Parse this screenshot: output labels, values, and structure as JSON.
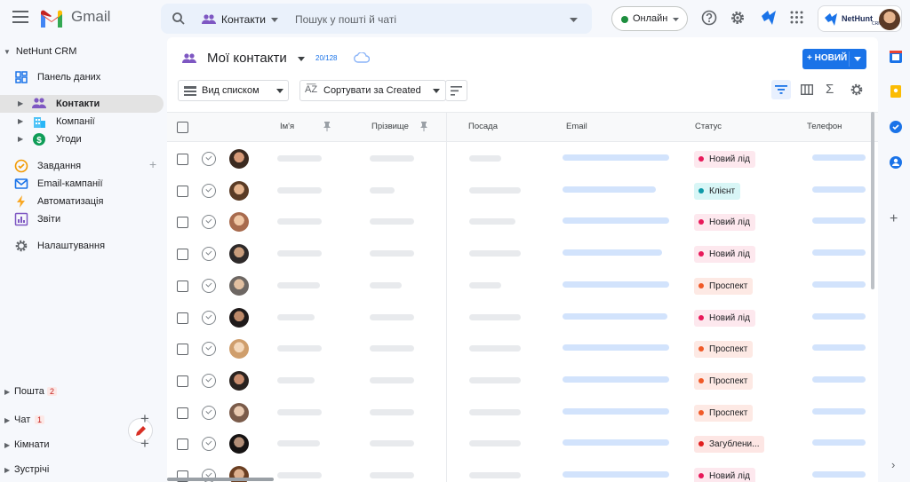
{
  "app": {
    "name": "Gmail"
  },
  "search": {
    "chip": "Контакти",
    "placeholder": "Пошук у пошті й чаті"
  },
  "status": {
    "label": "Онлайн",
    "color": "#1e8e3e"
  },
  "nethunt": {
    "name": "NetHunt",
    "sub": "CRM"
  },
  "sidebar": {
    "title": "NetHunt CRM",
    "items": [
      {
        "label": "Панель даних",
        "icon": "dashboard-icon"
      },
      {
        "label": "Контакти",
        "icon": "people-icon",
        "active": true
      },
      {
        "label": "Компанії",
        "icon": "building-icon"
      },
      {
        "label": "Угоди",
        "icon": "dollar-icon"
      },
      {
        "label": "Завдання",
        "icon": "task-check-icon"
      },
      {
        "label": "Email-кампанії",
        "icon": "email-icon"
      },
      {
        "label": "Автоматизація",
        "icon": "bolt-icon"
      },
      {
        "label": "Звіти",
        "icon": "chart-icon"
      },
      {
        "label": "Налаштування",
        "icon": "gear-icon"
      }
    ],
    "bottom": [
      {
        "label": "Пошта",
        "count": "2"
      },
      {
        "label": "Чат",
        "count": "1"
      },
      {
        "label": "Кімнати"
      },
      {
        "label": "Зустрічі"
      }
    ]
  },
  "view": {
    "title": "Мої контакти",
    "count": "20/128",
    "new_label": "+ НОВИЙ",
    "view_label": "Вид списком",
    "sort_prefix": "Сортувати за ",
    "sort_field": "Created"
  },
  "table": {
    "headers": [
      "Ім'я",
      "Прізвище",
      "Посада",
      "Email",
      "Статус",
      "Телефон"
    ],
    "rows": [
      {
        "status": "Новий лід"
      },
      {
        "status": "Клієнт"
      },
      {
        "status": "Новий лід"
      },
      {
        "status": "Новий лід"
      },
      {
        "status": "Проспект"
      },
      {
        "status": "Новий лід"
      },
      {
        "status": "Проспект"
      },
      {
        "status": "Проспект"
      },
      {
        "status": "Проспект"
      },
      {
        "status": "Загублени..."
      },
      {
        "status": "Новий лід"
      }
    ]
  },
  "status_colors": {
    "Новий лід": {
      "bg": "#fde8ee",
      "dot": "#e8195a"
    },
    "Клієнт": {
      "bg": "#d8f6f6",
      "dot": "#0e9aa8"
    },
    "Проспект": {
      "bg": "#fde9e4",
      "dot": "#f05a28"
    },
    "Загублени...": {
      "bg": "#fde6e4",
      "dot": "#e11f1f"
    }
  }
}
